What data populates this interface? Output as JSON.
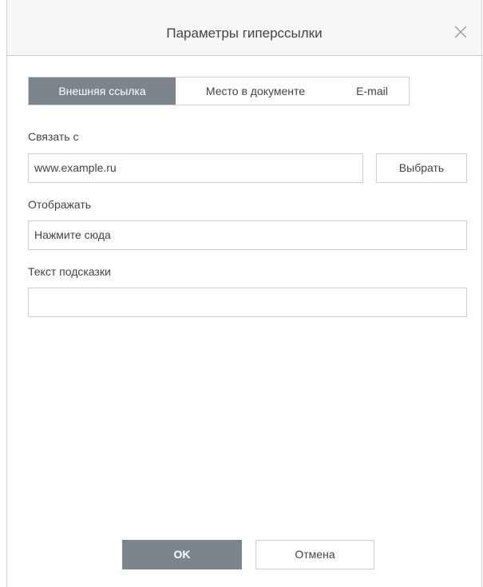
{
  "dialog": {
    "title": "Параметры гиперссылки",
    "close_icon": "close-icon"
  },
  "tabs": [
    {
      "label": "Внешняя ссылка",
      "active": true
    },
    {
      "label": "Место в документе",
      "active": false
    },
    {
      "label": "E-mail",
      "active": false
    }
  ],
  "fields": {
    "link_label": "Связать с",
    "link_value": "www.example.ru",
    "browse_button": "Выбрать",
    "display_label": "Отображать",
    "display_value": "Нажмите сюда",
    "tooltip_label": "Текст подсказки",
    "tooltip_value": ""
  },
  "footer": {
    "ok_label": "OK",
    "cancel_label": "Отмена"
  },
  "colors": {
    "accent": "#7d858c",
    "border": "#cfcfcf",
    "text": "#444444"
  }
}
